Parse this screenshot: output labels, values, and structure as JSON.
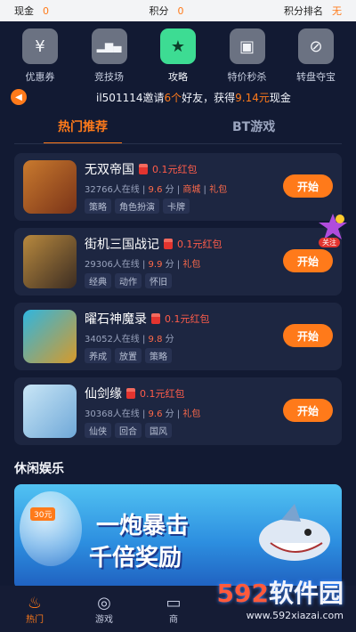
{
  "statusbar": {
    "cash_label": "现金",
    "cash_value": "0",
    "points_label": "积分",
    "points_value": "0",
    "rank_label": "积分排名",
    "rank_value": "无"
  },
  "quick_menu": [
    {
      "label": "优惠券",
      "icon": "coupon-icon",
      "glyph": "¥"
    },
    {
      "label": "竞技场",
      "icon": "podium-icon",
      "glyph": "▂▆▄"
    },
    {
      "label": "攻略",
      "icon": "guide-icon",
      "glyph": "★"
    },
    {
      "label": "特价秒杀",
      "icon": "gift-icon",
      "glyph": "▣"
    },
    {
      "label": "转盘夺宝",
      "icon": "wheel-icon",
      "glyph": "⊘"
    }
  ],
  "notice": {
    "prefix": "il501114邀请",
    "count": "6个",
    "middle": "好友，获得",
    "reward": "9.14元",
    "suffix": "现金"
  },
  "tabs": {
    "hot": "热门推荐",
    "bt": "BT游戏"
  },
  "games": [
    {
      "name": "无双帝国",
      "bonus": "0.1元红包",
      "online": "32766人在线",
      "score": "9.6",
      "score_unit": "分",
      "extra1": "商城",
      "extra2": "礼包",
      "tags": [
        "策略",
        "角色扮演",
        "卡牌"
      ],
      "start": "开始",
      "colors": [
        "#c97a2e",
        "#7a3318"
      ]
    },
    {
      "name": "街机三国战记",
      "bonus": "0.1元红包",
      "online": "29306人在线",
      "score": "9.9",
      "score_unit": "分",
      "extra1": "",
      "extra2": "礼包",
      "tags": [
        "经典",
        "动作",
        "怀旧"
      ],
      "start": "开始",
      "colors": [
        "#b8893e",
        "#3b2c22"
      ]
    },
    {
      "name": "曜石神魔录",
      "bonus": "0.1元红包",
      "online": "34052人在线",
      "score": "9.8",
      "score_unit": "分",
      "extra1": "",
      "extra2": "",
      "tags": [
        "养成",
        "放置",
        "策略"
      ],
      "start": "开始",
      "colors": [
        "#2fb6e0",
        "#d79a2a"
      ]
    },
    {
      "name": "仙剑缘",
      "bonus": "0.1元红包",
      "online": "30368人在线",
      "score": "9.6",
      "score_unit": "分",
      "extra1": "",
      "extra2": "礼包",
      "tags": [
        "仙侠",
        "回合",
        "国风"
      ],
      "start": "开始",
      "colors": [
        "#c9e6f6",
        "#6fa8d8"
      ]
    }
  ],
  "follow_badge": "关注",
  "leisure": {
    "title": "休闲娱乐",
    "banner_amount": "30元",
    "banner_line1": "一炮暴击",
    "banner_line2": "千倍奖励"
  },
  "bottom_nav": [
    {
      "label": "热门",
      "icon": "flame-icon",
      "glyph": "♨"
    },
    {
      "label": "游戏",
      "icon": "gamepad-icon",
      "glyph": "◎"
    },
    {
      "label": "商",
      "icon": "shop-icon",
      "glyph": "▭"
    }
  ],
  "watermark": {
    "num": "592",
    "brand": "软件园",
    "url": "www.592xiazai.com"
  },
  "colors": {
    "accent": "#ff7a1a",
    "bg": "#121a33",
    "card": "#1d2641",
    "active_icon": "#3ddc93"
  }
}
